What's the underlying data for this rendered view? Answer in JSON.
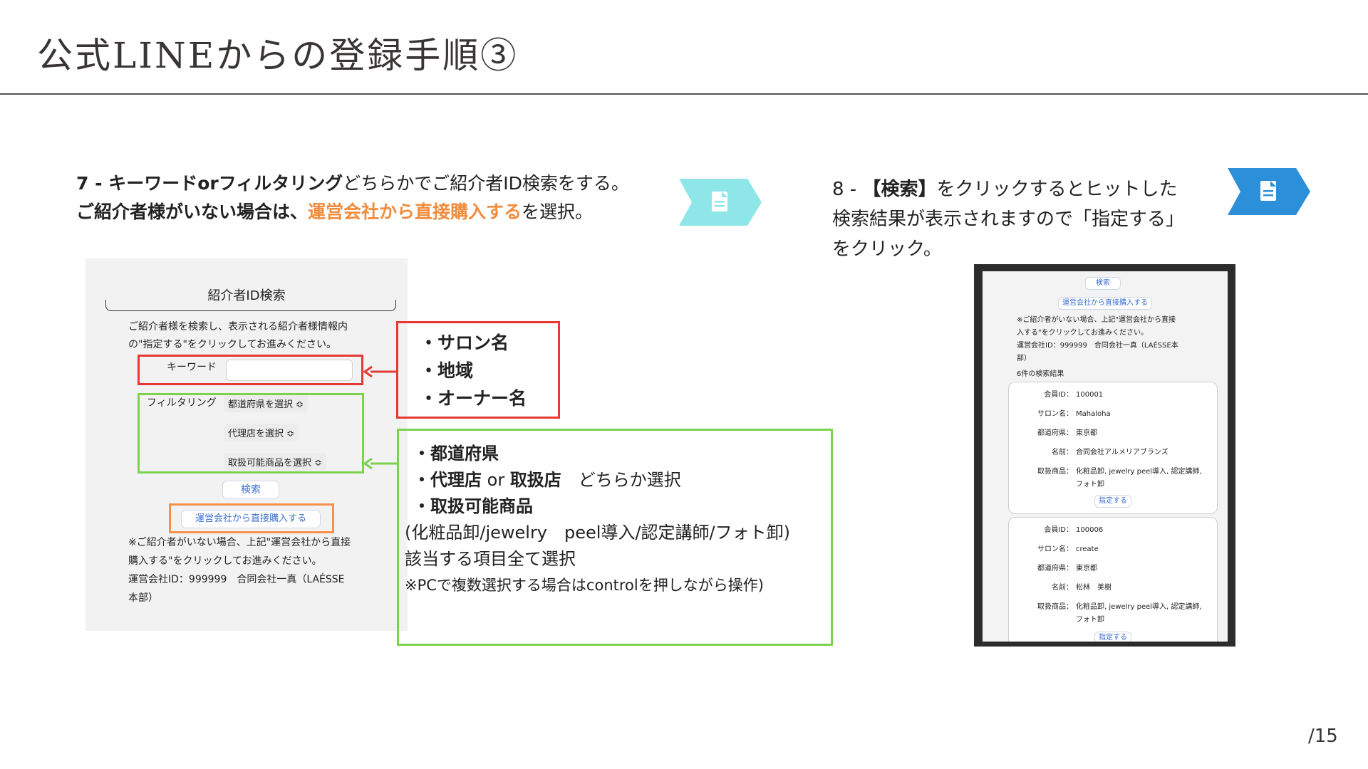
{
  "header": {
    "title": "公式LINEからの登録手順③"
  },
  "step7": {
    "line1_prefix": "7 - ",
    "line1_bold": "キーワードorフィルタリング",
    "line1_rest": "どちらかでご紹介者ID検索をする。",
    "line2_bold": "ご紹介者様がいない場合は、",
    "line2_orange": "運営会社から直接購入する",
    "line2_rest": "を選択。"
  },
  "step8": {
    "line1_prefix": "8 - ",
    "line1_bold": "【検索】",
    "line1_rest": "をクリックするとヒットした",
    "line2": "検索結果が表示されますので「指定する」",
    "line3": "をクリック。"
  },
  "colors": {
    "cyan_badge": "#8ee6e8",
    "blue_badge": "#2b8fd9",
    "red": "#e53935",
    "green": "#7cd24f",
    "orange": "#f08c3c"
  },
  "icons": {
    "badge": "document-icon"
  },
  "form": {
    "title": "紹介者ID検索",
    "desc1": "ご紹介者様を検索し、表示される紹介者様情報内",
    "desc2": "の\"指定する\"をクリックしてお進みください。",
    "keyword_label": "キーワード",
    "filter_label": "フィルタリング",
    "select_pref": "都道府県を選択 ≎",
    "select_agent": "代理店を選択 ≎",
    "select_product": "取扱可能商品を選択 ≎",
    "search_button": "検索",
    "direct_button": "運営会社から直接購入する",
    "foot1": "※ご紹介者がいない場合、上記\"運営会社から直接",
    "foot2": "購入する\"をクリックしてお進みください。",
    "foot3": "運営会社ID：999999　合同会社一真（LAÉSSE",
    "foot4": "本部）"
  },
  "callout_red": {
    "items": [
      "・サロン名",
      "・地域",
      "・オーナー名"
    ]
  },
  "callout_green": {
    "l1": "・都道府県",
    "l2_a": "・代理店",
    "l2_b": " or ",
    "l2_c": "取扱店",
    "l2_d": "　どちらか選択",
    "l3": "・取扱可能商品",
    "l4": "(化粧品卸/jewelry　peel導入/認定講師/フォト卸)",
    "l5": "該当する項目全て選択",
    "l6": "※PCで複数選択する場合はcontrolを押しながら操作)"
  },
  "phone": {
    "search_button": "検索",
    "direct_button": "運営会社から直接購入する",
    "note1": "※ご紹介者がいない場合、上記\"運営会社から直接",
    "note2": "入する\"をクリックしてお進みください。",
    "note3": "運営会社ID：999999　合同会社一真（LAÉSSE本",
    "note4": "部）",
    "results_count": "6件の検索結果",
    "results": [
      {
        "id_key": "会員ID：",
        "id": "100001",
        "salon_key": "サロン名：",
        "salon": "Mahaloha",
        "pref_key": "都道府県：",
        "pref": "東京都",
        "name_key": "名前：",
        "name": "合同会社アルメリアブランズ",
        "prod_key": "取扱商品：",
        "prod1": "化粧品卸, jewelry peel導入, 認定講師,",
        "prod2": "フォト卸",
        "assign": "指定する"
      },
      {
        "id_key": "会員ID：",
        "id": "100006",
        "salon_key": "サロン名：",
        "salon": "create",
        "pref_key": "都道府県：",
        "pref": "東京都",
        "name_key": "名前：",
        "name": "松林　美樹",
        "prod_key": "取扱商品：",
        "prod1": "化粧品卸, jewelry peel導入, 認定講師,",
        "prod2": "フォト卸",
        "assign": "指定する"
      }
    ]
  },
  "footer": {
    "page": "/15"
  }
}
